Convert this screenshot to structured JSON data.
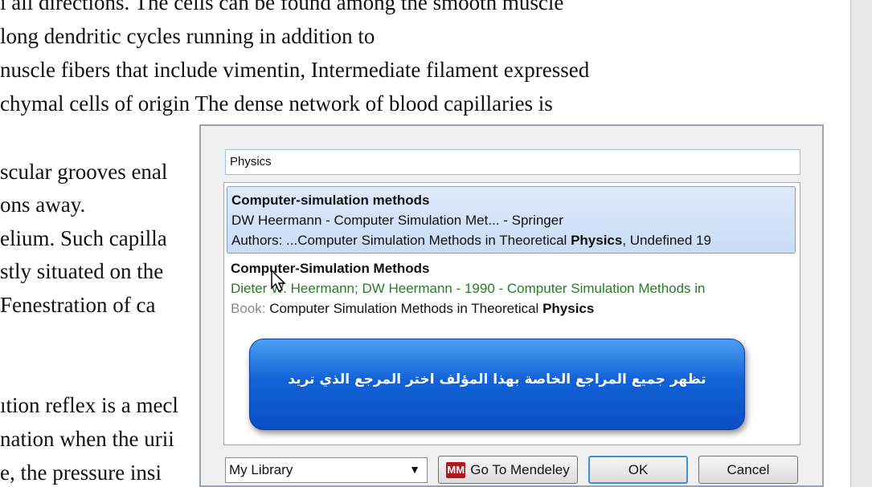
{
  "document": {
    "lines": [
      "ı all directions. The cells can be found among the smooth muscle",
      " long dendritic cycles running in addition to",
      "nuscle fibers that include vimentin, Intermediate filament expressed",
      "chymal cells of origin The dense network of blood capillaries is",
      "scular grooves enal",
      "ons away.",
      "elium. Such capilla",
      "stly situated on the",
      "  Fenestration of ca",
      "ıtion reflex is a mecl",
      "nation when the urii",
      "e, the pressure insi"
    ]
  },
  "dialog": {
    "search_value": "Physics",
    "results": [
      {
        "title": "Computer-simulation methods",
        "line2": "DW Heermann - Computer Simulation Met... - Springer",
        "line3_prefix": "Authors: ...Computer Simulation Methods in Theoretical ",
        "line3_bold": "Physics",
        "line3_suffix": ", Undefined 19"
      },
      {
        "title": "Computer-Simulation Methods",
        "line2": "Dieter W. Heermann; DW Heermann - 1990 - Computer Simulation Methods in",
        "line3_label": "Book: ",
        "line3_prefix": "Computer Simulation Methods in Theoretical ",
        "line3_bold": "Physics"
      }
    ],
    "library_value": "My Library",
    "mendeley_label": "Go To Mendeley",
    "ok_label": "OK",
    "cancel_label": "Cancel"
  },
  "annotation": {
    "text": "تظهر جميع المراجع الخاصة بهذا المؤلف اختر المرجع الذي تريد"
  },
  "icons": {
    "mendeley": "mendeley-icon",
    "dropdown": "chevron-down-icon",
    "cursor": "mouse-cursor-icon"
  }
}
